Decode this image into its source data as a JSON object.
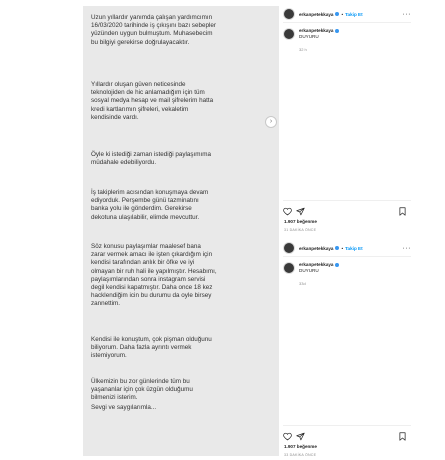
{
  "post_text": {
    "p1": "Uzun yıllardır yanımda çalışan yardımcımın\n16/03/2020 tarihinde iş çıkışını bazı sebepler\nyüzünden uygun bulmuştum. Muhasebecim\nbu bilgiyi gerekirse doğrulayacaktır.",
    "p2": "Yıllardır oluşan güven neticesinde\nteknolojiden de hic anlamadığım için tüm\nsosyal medya hesap ve mail şifrelerim hatta\nkredi kartlarımın şifreleri, vekaletim\nkendisinde vardı.",
    "p3": "Öyle ki istediği zaman istediği paylaşımıma\nmüdahale edebiliyordu.",
    "p4": "İş takiplerim acısından konuşmaya devam\nediyorduk. Perşembe günü tazminatını\nbanka yolu ile gönderdim. Gerekirse\ndekotuna ulaşılabilir, elimde mevcuttur.",
    "p5": "Söz konusu paylaşımlar maalesef bana\nzarar vermek amacı ile işten çıkardığım için\nkendisi tarafından anlık bir öfke ve iyi\nolmayan bir ruh hali ile yapılmıştır. Hesabımı,\npaylaşımlarından sonra instagram servisi\ndegil kendisi kapatmıştır. Daha once 18 kez\nhacklendiğim icin bu durumu da oyle birsey\nzannettim.",
    "p6": "Kendisi ile konuştum, çok pişman olduğunu\nbiliyorum. Daha fazla ayrıntı vermek\nistemiyorum.",
    "p7": "Ülkemizin bu zor günlerinde tüm bu\nyaşananlar için çok üzgün olduğumu\nbilmenizi isterim.",
    "p8": "Sevgi ve saygılarımla..."
  },
  "panel_top": {
    "username": "erkanpetekkaya",
    "follow": "Takip Et",
    "dot": "•",
    "more": "···",
    "comment_user": "erkanpetekkaya",
    "comment_text": "DUYURU",
    "comment_time": "32 h",
    "likes": "1.907 beğenme",
    "date": "31 DAKİKA ÖNCE"
  },
  "panel_bottom": {
    "username": "erkanpetekkaya",
    "follow": "Takip Et",
    "dot": "•",
    "more": "···",
    "comment_user": "erkanpetekkaya",
    "comment_text": "DUYURU",
    "comment_time": "33d",
    "likes": "1.907 beğenme",
    "date": "33 DAKİKA ÖNCE"
  },
  "icons": {
    "next": "›",
    "heart": "heart-icon",
    "share": "share-icon",
    "save": "bookmark-icon"
  },
  "colors": {
    "link": "#0095f6",
    "verified": "#3897f0",
    "image_bg": "#e9e9e9"
  }
}
